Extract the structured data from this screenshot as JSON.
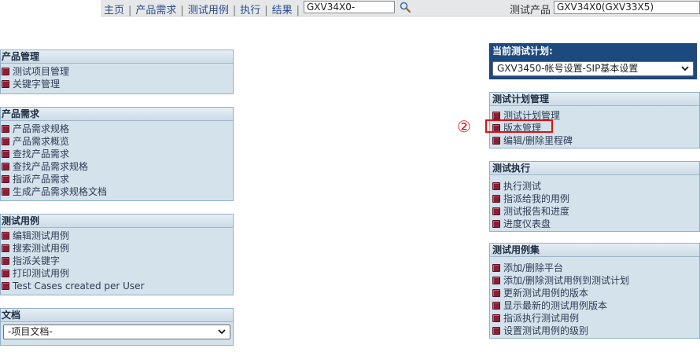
{
  "nav": {
    "items": [
      "主页",
      "产品需求",
      "测试用例",
      "执行",
      "结果"
    ],
    "search_value": "GXV34X0-",
    "product_label": "测试产品",
    "product_value": "GXV34X0(GXV33X5)"
  },
  "left": {
    "product_mgmt": {
      "title": "产品管理",
      "items": [
        "测试项目管理",
        "关键字管理"
      ]
    },
    "requirements": {
      "title": "产品需求",
      "items": [
        "产品需求规格",
        "产品需求概览",
        "查找产品需求",
        "查找产品需求规格",
        "指派产品需求",
        "生成产品需求规格文档"
      ]
    },
    "testcases": {
      "title": "测试用例",
      "items": [
        "编辑测试用例",
        "搜索测试用例",
        "指派关键字",
        "打印测试用例",
        "Test Cases created per User"
      ]
    },
    "docs": {
      "title": "文档",
      "selected": "-项目文档-"
    }
  },
  "right": {
    "current_plan": {
      "title": "当前测试计划:",
      "selected": "GXV3450-帐号设置-SIP基本设置"
    },
    "plan_mgmt": {
      "title": "测试计划管理",
      "items": [
        "测试计划管理",
        "版本管理",
        "编辑/删除里程碑"
      ]
    },
    "execution": {
      "title": "测试执行",
      "items": [
        "执行测试",
        "指派给我的用例",
        "测试报告和进度",
        "进度仪表盘"
      ]
    },
    "suite": {
      "title": "测试用例集",
      "items": [
        "添加/删除平台",
        "添加/删除测试用例到测试计划",
        "更新测试用例的版本",
        "显示最新的测试用例版本",
        "指派执行测试用例",
        "设置测试用例的级别"
      ]
    }
  },
  "annotation": {
    "marker": "②"
  },
  "colors": {
    "accent_red": "#e01010",
    "panel_bg": "#d4e2ec",
    "plan_bg": "#1d4a7e"
  }
}
